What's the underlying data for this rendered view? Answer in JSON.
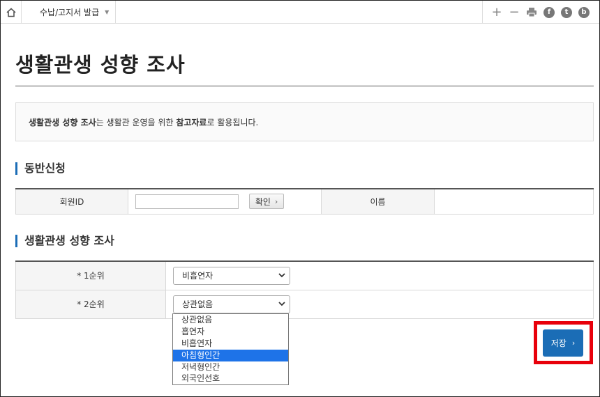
{
  "breadcrumb": {
    "label": "수납/고지서 발급"
  },
  "page": {
    "title": "생활관생 성향 조사"
  },
  "notice": {
    "part1": "생활관생 성향 조사",
    "part2": "는 생활관 운영을 위한 ",
    "part3": "참고자료",
    "part4": "로 활용됩니다."
  },
  "companion": {
    "heading": "동반신청",
    "member_id_label": "회원ID",
    "member_id_value": "",
    "check_button": "확인",
    "name_label": "이름",
    "name_value": ""
  },
  "survey": {
    "heading": "생활관생 성향 조사",
    "rank1_label": "* 1순위",
    "rank1_value": "비흡연자",
    "rank2_label": "* 2순위",
    "rank2_value": "상관없음",
    "options": [
      "상관없음",
      "흡연자",
      "비흡연자",
      "아침형인간",
      "저녁형인간",
      "외국인선호"
    ],
    "highlighted_option": "아침형인간"
  },
  "save_button": "저장",
  "colors": {
    "accent": "#1b6db6",
    "highlight_border": "#e8000b",
    "option_selected": "#1e73e8"
  }
}
